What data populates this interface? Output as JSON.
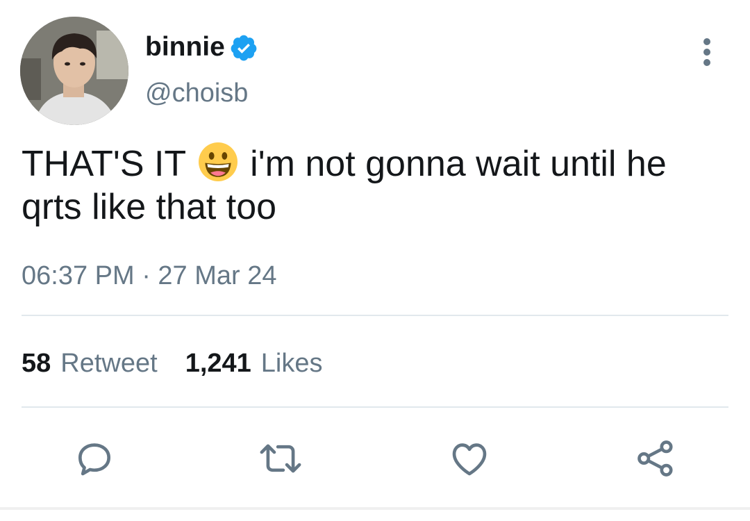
{
  "user": {
    "display_name": "binnie",
    "handle": "@choisb",
    "verified": true
  },
  "tweet": {
    "text_before_emoji": "THAT'S IT",
    "emoji": "grinning-face-emoji",
    "text_after_emoji": "i'm not gonna wait until he qrts like that too",
    "timestamp": "06:37 PM · 27 Mar 24"
  },
  "stats": {
    "retweet_count": "58",
    "retweet_label": "Retweet",
    "likes_count": "1,241",
    "likes_label": "Likes"
  },
  "actions": {
    "icons": [
      "reply-icon",
      "retweet-icon",
      "like-icon",
      "share-icon"
    ]
  },
  "colors": {
    "text_primary": "#14171a",
    "text_secondary": "#657786",
    "verified_blue": "#1da1f2",
    "divider": "#e1e8ed"
  }
}
